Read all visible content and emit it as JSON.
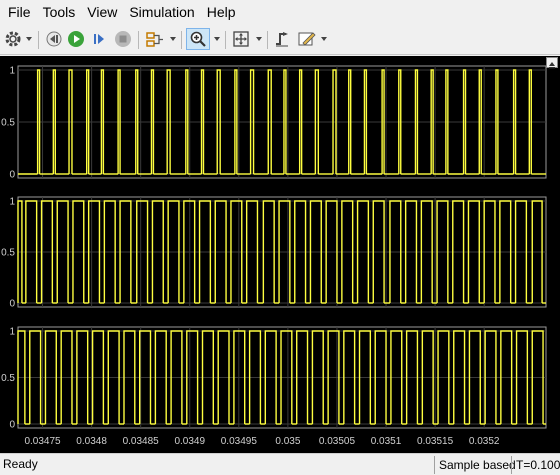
{
  "menu": [
    "File",
    "Tools",
    "View",
    "Simulation",
    "Help"
  ],
  "toolbar": {
    "icons": [
      "gear-icon",
      "step-back-icon",
      "run-icon",
      "step-forward-icon",
      "stop-icon",
      "signal-select-icon",
      "zoom-in-icon",
      "fit-to-view-icon",
      "trigger-icon",
      "style-icon"
    ],
    "accent_run": "#3aa33a",
    "accent_active": "#cde6f7"
  },
  "scope": {
    "background": "#000000",
    "axes_background": "#000000",
    "grid_color": "#3a3a3a",
    "line_color": "#ffff40",
    "tick_label_color": "#d0d0d0",
    "y_ticks": [
      "0",
      "0.5",
      "1"
    ],
    "x_ticks": [
      "0.03475",
      "0.0348",
      "0.03485",
      "0.0349",
      "0.03495",
      "0.035",
      "0.03505",
      "0.0351",
      "0.03515",
      "0.0352"
    ],
    "undock_icon": "undock-icon"
  },
  "chart_data": [
    {
      "type": "line",
      "ylim": [
        0,
        1
      ],
      "xlim": [
        0.034725,
        0.035263
      ],
      "series": [
        {
          "values": [
            [
              0.034745,
              0.034747
            ],
            [
              0.034761,
              0.034763
            ],
            [
              0.034777,
              0.03478
            ],
            [
              0.034795,
              0.034797
            ],
            [
              0.03481,
              0.034812
            ],
            [
              0.034827,
              0.034829
            ],
            [
              0.034845,
              0.034847
            ],
            [
              0.034861,
              0.034863
            ],
            [
              0.034877,
              0.03488
            ],
            [
              0.034896,
              0.034898
            ],
            [
              0.034912,
              0.034914
            ],
            [
              0.034928,
              0.034931
            ],
            [
              0.034946,
              0.034948
            ],
            [
              0.034962,
              0.034965
            ],
            [
              0.03498,
              0.034983
            ],
            [
              0.034996,
              0.034998
            ],
            [
              0.035012,
              0.035014
            ],
            [
              0.035028,
              0.035031
            ],
            [
              0.035046,
              0.035049
            ],
            [
              0.035062,
              0.035064
            ],
            [
              0.035078,
              0.03508
            ],
            [
              0.035096,
              0.035098
            ],
            [
              0.035113,
              0.035115
            ],
            [
              0.03513,
              0.035132
            ],
            [
              0.035146,
              0.035148
            ],
            [
              0.035161,
              0.035163
            ],
            [
              0.035179,
              0.035181
            ],
            [
              0.035195,
              0.035197
            ],
            [
              0.035212,
              0.035214
            ],
            [
              0.03523,
              0.035232
            ],
            [
              0.035246,
              0.035248
            ]
          ]
        }
      ]
    },
    {
      "type": "line",
      "ylim": [
        0,
        1
      ],
      "xlim": [
        0.034725,
        0.035263
      ],
      "series": [
        {
          "values": [
            [
              0.034725,
              0.034729
            ],
            [
              0.034733,
              0.034744
            ],
            [
              0.034749,
              0.03476
            ],
            [
              0.034765,
              0.034776
            ],
            [
              0.034781,
              0.034792
            ],
            [
              0.034797,
              0.034808
            ],
            [
              0.034813,
              0.034824
            ],
            [
              0.034829,
              0.03484
            ],
            [
              0.034846,
              0.034857
            ],
            [
              0.034862,
              0.034873
            ],
            [
              0.034878,
              0.034889
            ],
            [
              0.034894,
              0.034905
            ],
            [
              0.03491,
              0.034921
            ],
            [
              0.034926,
              0.034937
            ],
            [
              0.034942,
              0.034953
            ],
            [
              0.034958,
              0.034969
            ],
            [
              0.034975,
              0.034986
            ],
            [
              0.034991,
              0.035002
            ],
            [
              0.035007,
              0.035018
            ],
            [
              0.035023,
              0.035034
            ],
            [
              0.035039,
              0.03505
            ],
            [
              0.035055,
              0.035066
            ],
            [
              0.035071,
              0.035082
            ],
            [
              0.035087,
              0.035098
            ],
            [
              0.035104,
              0.035115
            ],
            [
              0.03512,
              0.035131
            ],
            [
              0.035136,
              0.035147
            ],
            [
              0.035152,
              0.035163
            ],
            [
              0.035168,
              0.035179
            ],
            [
              0.035184,
              0.035195
            ],
            [
              0.0352,
              0.035211
            ],
            [
              0.035216,
              0.035227
            ],
            [
              0.035232,
              0.035243
            ],
            [
              0.035249,
              0.035259
            ]
          ]
        }
      ]
    },
    {
      "type": "line",
      "ylim": [
        0,
        1
      ],
      "xlim": [
        0.034725,
        0.035263
      ],
      "series": [
        {
          "values": [
            [
              0.034725,
              0.034732
            ],
            [
              0.034737,
              0.034748
            ],
            [
              0.034753,
              0.034764
            ],
            [
              0.034769,
              0.03478
            ],
            [
              0.034785,
              0.034796
            ],
            [
              0.034801,
              0.034812
            ],
            [
              0.034817,
              0.034828
            ],
            [
              0.034833,
              0.034844
            ],
            [
              0.034849,
              0.03486
            ],
            [
              0.034865,
              0.034876
            ],
            [
              0.034881,
              0.034892
            ],
            [
              0.034897,
              0.034908
            ],
            [
              0.034913,
              0.034924
            ],
            [
              0.034929,
              0.03494
            ],
            [
              0.034945,
              0.034956
            ],
            [
              0.034961,
              0.034972
            ],
            [
              0.034977,
              0.034988
            ],
            [
              0.034993,
              0.035004
            ],
            [
              0.035009,
              0.03502
            ],
            [
              0.035025,
              0.035036
            ],
            [
              0.035041,
              0.035052
            ],
            [
              0.035057,
              0.035068
            ],
            [
              0.035073,
              0.035084
            ],
            [
              0.035089,
              0.0351
            ],
            [
              0.035105,
              0.035116
            ],
            [
              0.035121,
              0.035132
            ],
            [
              0.035137,
              0.035148
            ],
            [
              0.035153,
              0.035164
            ],
            [
              0.035169,
              0.03518
            ],
            [
              0.035185,
              0.035196
            ],
            [
              0.035201,
              0.035212
            ],
            [
              0.035217,
              0.035228
            ],
            [
              0.035233,
              0.035244
            ],
            [
              0.035249,
              0.03526
            ]
          ]
        }
      ]
    }
  ],
  "status": {
    "left": "Ready",
    "sample": "Sample based",
    "time": "T=0.100"
  }
}
